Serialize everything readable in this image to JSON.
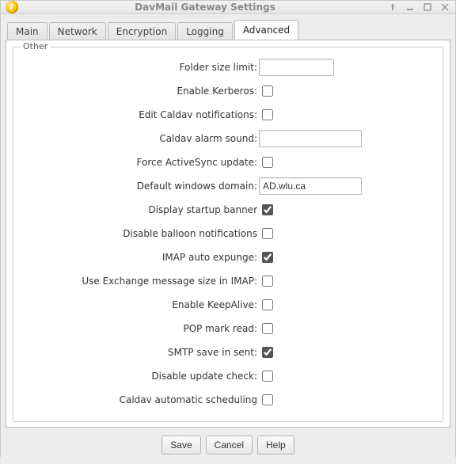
{
  "window": {
    "title": "DavMail Gateway Settings"
  },
  "tabs": {
    "main": "Main",
    "network": "Network",
    "encryption": "Encryption",
    "logging": "Logging",
    "advanced": "Advanced"
  },
  "group": {
    "legend": "Other"
  },
  "fields": {
    "folder_size_limit": {
      "label": "Folder size limit:",
      "value": ""
    },
    "enable_kerberos": {
      "label": "Enable Kerberos:",
      "checked": false
    },
    "edit_caldav_notifications": {
      "label": "Edit Caldav notifications:",
      "checked": false
    },
    "caldav_alarm_sound": {
      "label": "Caldav alarm sound:",
      "value": ""
    },
    "force_activesync_update": {
      "label": "Force ActiveSync update:",
      "checked": false
    },
    "default_windows_domain": {
      "label": "Default windows domain:",
      "value": "AD.wlu.ca"
    },
    "display_startup_banner": {
      "label": "Display startup banner",
      "checked": true
    },
    "disable_balloon_notifications": {
      "label": "Disable balloon notifications",
      "checked": false
    },
    "imap_auto_expunge": {
      "label": "IMAP auto expunge:",
      "checked": true
    },
    "use_exchange_message_size_imap": {
      "label": "Use Exchange message size in IMAP:",
      "checked": false
    },
    "enable_keepalive": {
      "label": "Enable KeepAlive:",
      "checked": false
    },
    "pop_mark_read": {
      "label": "POP mark read:",
      "checked": false
    },
    "smtp_save_in_sent": {
      "label": "SMTP save in sent:",
      "checked": true
    },
    "disable_update_check": {
      "label": "Disable update check:",
      "checked": false
    },
    "caldav_automatic_scheduling": {
      "label": "Caldav automatic scheduling",
      "checked": false
    }
  },
  "buttons": {
    "save": "Save",
    "cancel": "Cancel",
    "help": "Help"
  }
}
